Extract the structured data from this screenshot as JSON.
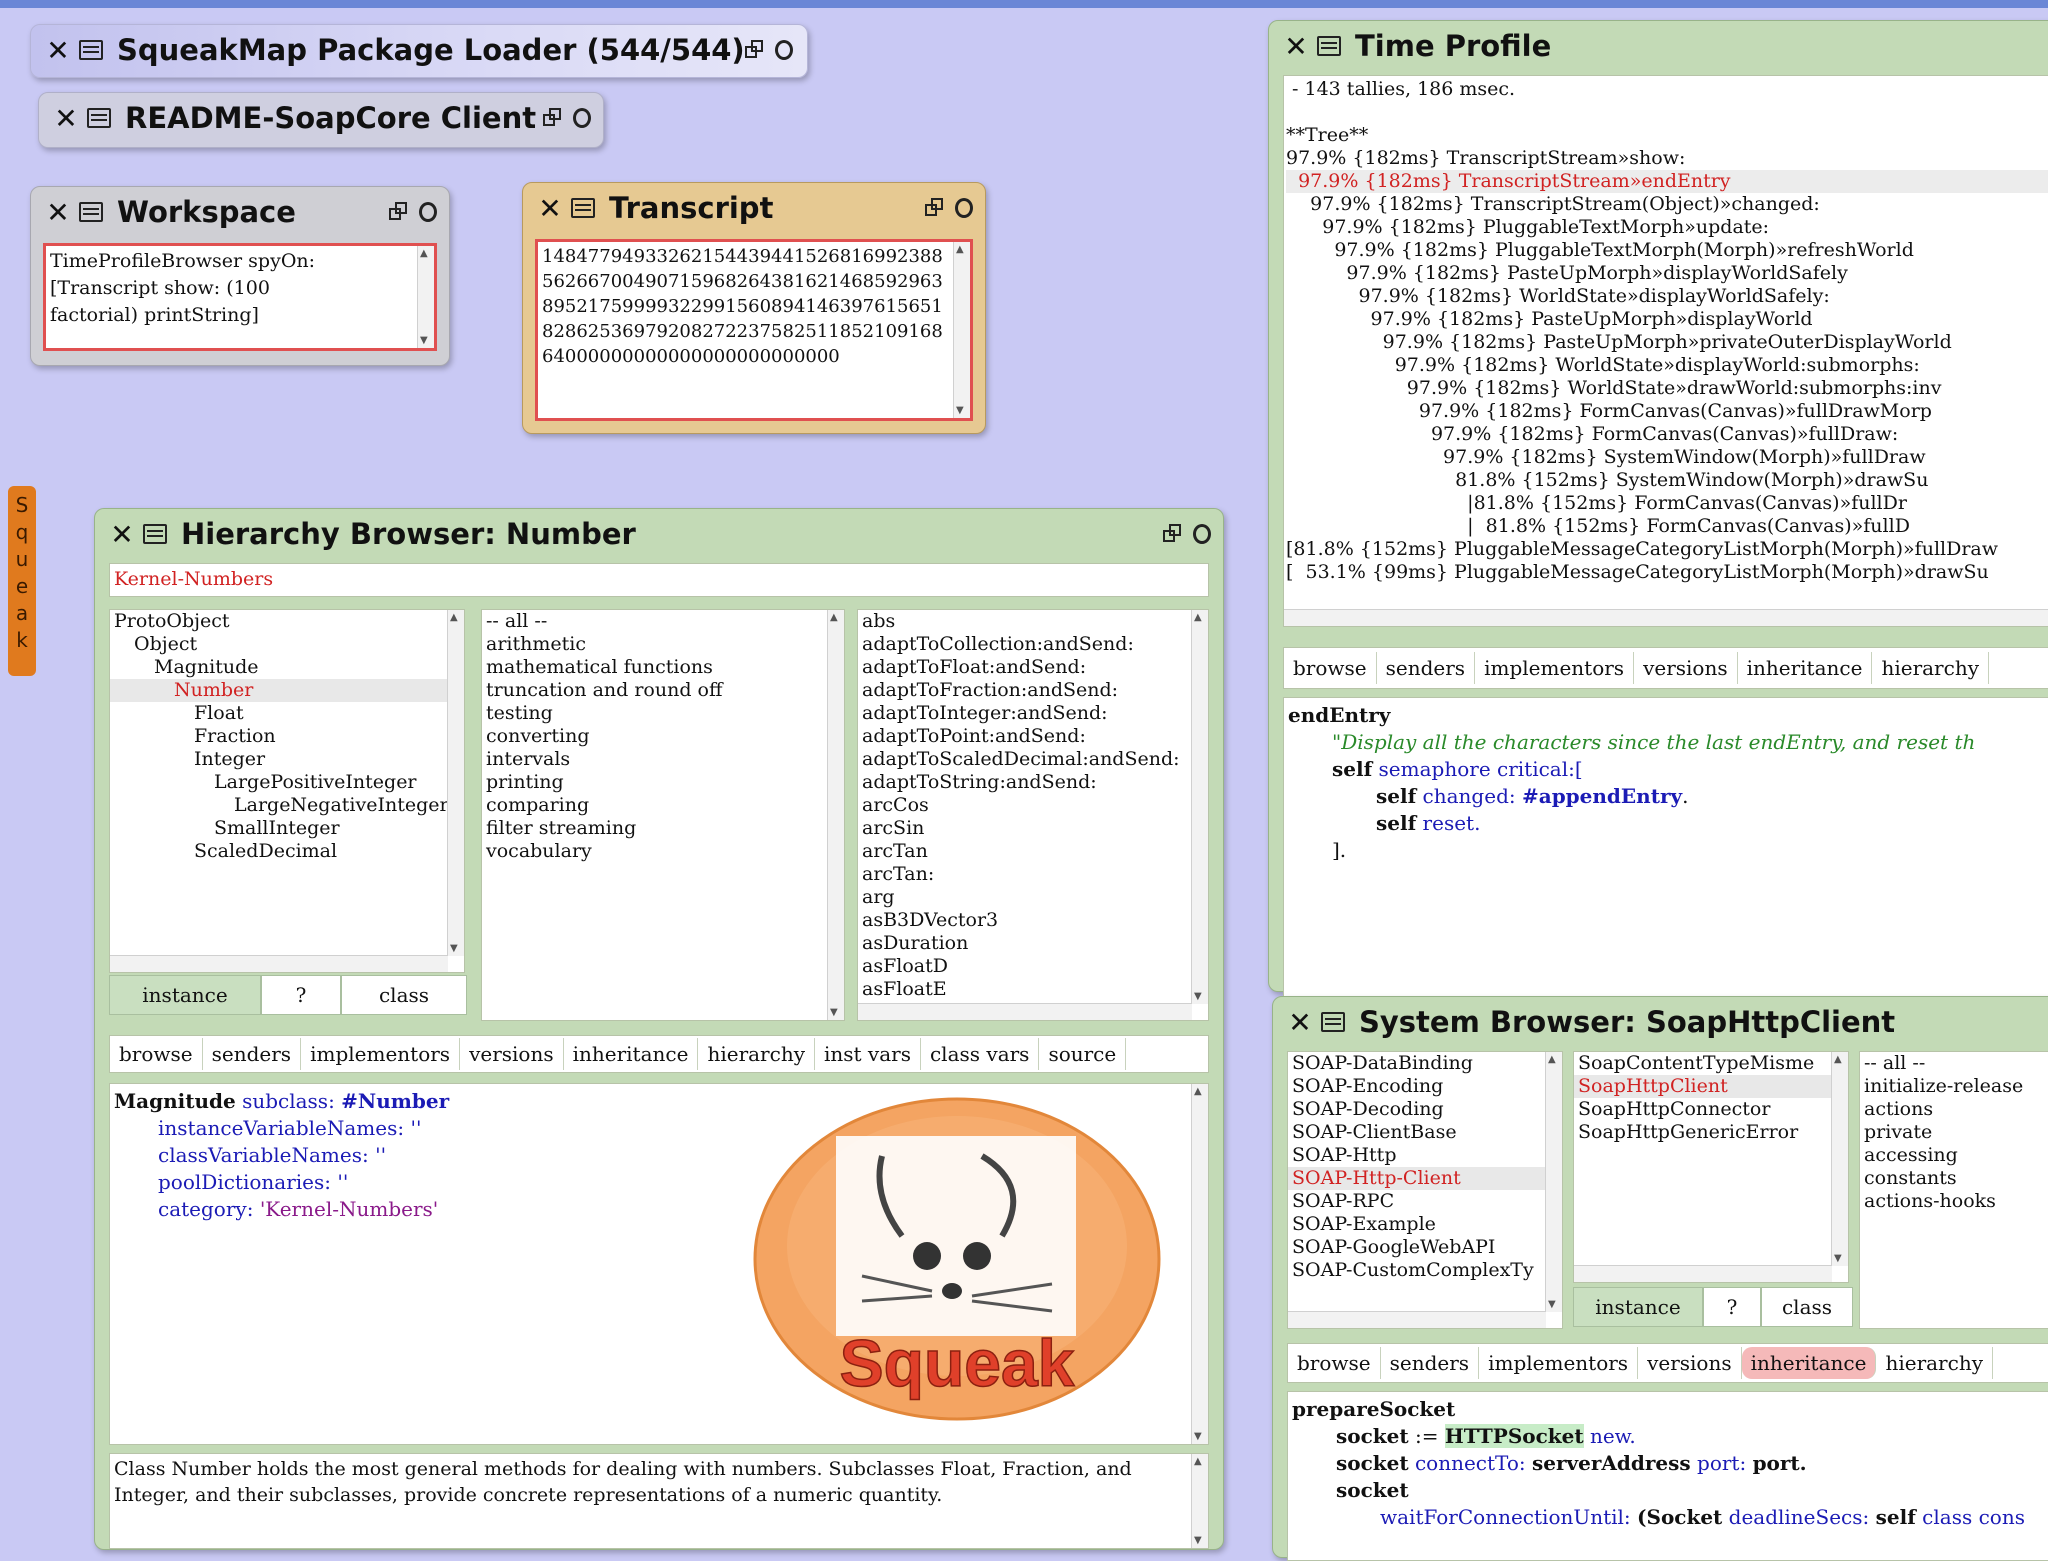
{
  "flap": {
    "label": "Squeak"
  },
  "package_loader": {
    "title": "SqueakMap Package Loader (544/544)"
  },
  "readme": {
    "title": "README-SoapCore Client"
  },
  "workspace": {
    "title": "Workspace",
    "code": "TimeProfileBrowser spyOn:\n[Transcript show: (100\nfactorial) printString]"
  },
  "transcript": {
    "title": "Transcript",
    "text": "1484779493326215443944152681699238856266700490715968264381621468592963895217599993229915608941463976156518286253697920827223758251185210916864000000000000000000000000"
  },
  "hierarchy": {
    "title": "Hierarchy Browser: Number",
    "category": "Kernel-Numbers",
    "classes": [
      "ProtoObject",
      "Object",
      "Magnitude",
      "Number",
      "Float",
      "Fraction",
      "Integer",
      "LargePositiveInteger",
      "LargeNegativeInteger",
      "SmallInteger",
      "ScaledDecimal"
    ],
    "protocols": [
      "-- all --",
      "arithmetic",
      "mathematical functions",
      "truncation and round off",
      "testing",
      "converting",
      "intervals",
      "printing",
      "comparing",
      "filter streaming",
      "vocabulary"
    ],
    "methods": [
      "abs",
      "adaptToCollection:andSend:",
      "adaptToFloat:andSend:",
      "adaptToFraction:andSend:",
      "adaptToInteger:andSend:",
      "adaptToPoint:andSend:",
      "adaptToScaledDecimal:andSend:",
      "adaptToString:andSend:",
      "arcCos",
      "arcSin",
      "arcTan",
      "arcTan:",
      "arg",
      "asB3DVector3",
      "asDuration",
      "asFloatD",
      "asFloatE"
    ],
    "switch": {
      "instance": "instance",
      "help": "?",
      "class": "class"
    },
    "buttons": [
      "browse",
      "senders",
      "implementors",
      "versions",
      "inheritance",
      "hierarchy",
      "inst vars",
      "class vars",
      "source"
    ],
    "definition": {
      "l1a": "Magnitude",
      "l1b": "subclass:",
      "l1c": "#Number",
      "l2": "instanceVariableNames: ''",
      "l3": "classVariableNames: ''",
      "l4": "poolDictionaries: ''",
      "l5a": "category:",
      "l5b": "'Kernel-Numbers'"
    },
    "logo_text": "Squeak",
    "comment": "Class Number holds the most general methods for dealing with numbers. Subclasses Float, Fraction, and Integer, and their subclasses, provide concrete representations of a numeric quantity."
  },
  "time_profile": {
    "title": "Time Profile",
    "lines": [
      " - 143 tallies, 186 msec.",
      "",
      "**Tree**",
      "97.9% {182ms} TranscriptStream»show:",
      "  97.9% {182ms} TranscriptStream»endEntry",
      "    97.9% {182ms} TranscriptStream(Object)»changed:",
      "      97.9% {182ms} PluggableTextMorph»update:",
      "        97.9% {182ms} PluggableTextMorph(Morph)»refreshWorld",
      "          97.9% {182ms} PasteUpMorph»displayWorldSafely",
      "            97.9% {182ms} WorldState»displayWorldSafely:",
      "              97.9% {182ms} PasteUpMorph»displayWorld",
      "                97.9% {182ms} PasteUpMorph»privateOuterDisplayWorld",
      "                  97.9% {182ms} WorldState»displayWorld:submorphs:",
      "                    97.9% {182ms} WorldState»drawWorld:submorphs:inv",
      "                      97.9% {182ms} FormCanvas(Canvas)»fullDrawMorp",
      "                        97.9% {182ms} FormCanvas(Canvas)»fullDraw:",
      "                          97.9% {182ms} SystemWindow(Morph)»fullDraw",
      "                            81.8% {152ms} SystemWindow(Morph)»drawSu",
      "                              |81.8% {152ms} FormCanvas(Canvas)»fullDr",
      "                              |  81.8% {152ms} FormCanvas(Canvas)»fullD",
      "[81.8% {152ms} PluggableMessageCategoryListMorph(Morph)»fullDraw",
      "[  53.1% {99ms} PluggableMessageCategoryListMorph(Morph)»drawSu"
    ],
    "buttons": [
      "browse",
      "senders",
      "implementors",
      "versions",
      "inheritance",
      "hierarchy"
    ],
    "code": {
      "sel": "endEntry",
      "comment": "\"Display all the characters since the last endEntry, and reset th",
      "l3a": "self",
      "l3b": "semaphore critical:[",
      "l4a": "self",
      "l4b": "changed:",
      "l4c": "#appendEntry",
      "l5a": "self",
      "l5b": "reset.",
      "l6": "]."
    }
  },
  "system_browser": {
    "title": "System Browser: SoapHttpClient",
    "categories": [
      "SOAP-DataBinding",
      "SOAP-Encoding",
      "SOAP-Decoding",
      "SOAP-ClientBase",
      "SOAP-Http",
      "SOAP-Http-Client",
      "SOAP-RPC",
      "SOAP-Example",
      "SOAP-GoogleWebAPI",
      "SOAP-CustomComplexTy"
    ],
    "classes": [
      "SoapContentTypeMisme",
      "SoapHttpClient",
      "SoapHttpConnector",
      "SoapHttpGenericError"
    ],
    "protocols": [
      "-- all --",
      "initialize-release",
      "actions",
      "private",
      "accessing",
      "constants",
      "actions-hooks"
    ],
    "switch": {
      "instance": "instance",
      "help": "?",
      "class": "class"
    },
    "buttons": [
      "browse",
      "senders",
      "implementors",
      "versions",
      "inheritance",
      "hierarchy"
    ],
    "code": {
      "sel": "prepareSocket",
      "l2a": "socket",
      "l2b": ":=",
      "l2c": "HTTPSocket",
      "l2d": "new.",
      "l3a": "socket",
      "l3b": "connectTo:",
      "l3c": "serverAddress",
      "l3d": "port:",
      "l3e": "port.",
      "l4": "socket",
      "l5a": "waitForConnectionUntil:",
      "l5b": "(Socket",
      "l5c": "deadlineSecs:",
      "l5d": "self",
      "l5e": "class cons"
    }
  }
}
